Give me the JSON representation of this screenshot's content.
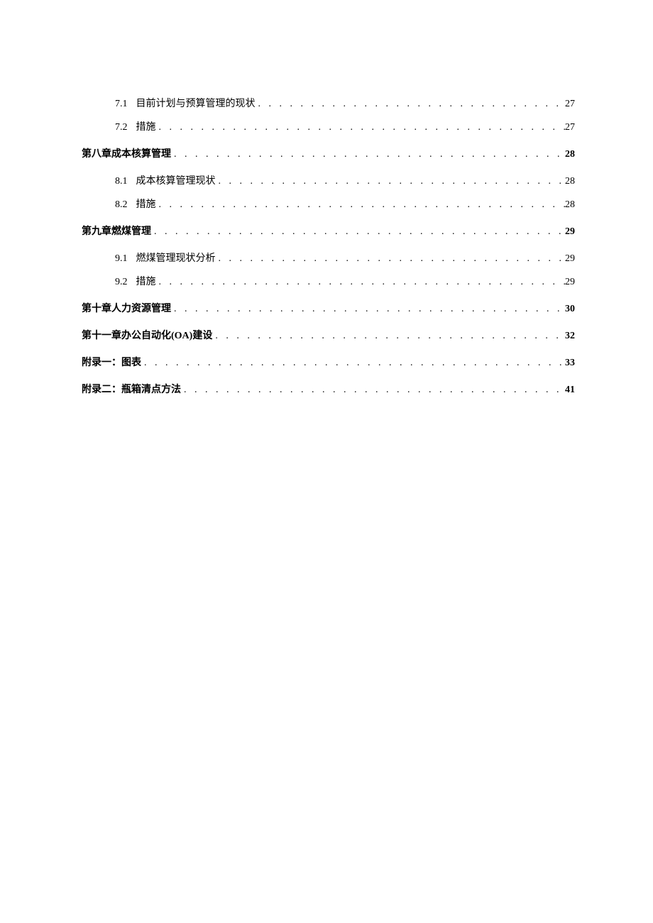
{
  "toc": {
    "entries": [
      {
        "level": 2,
        "number": "7.1",
        "title": "目前计划与预算管理的现状",
        "page": "27"
      },
      {
        "level": 2,
        "number": "7.2",
        "title": "措施",
        "page": "27"
      },
      {
        "level": 1,
        "number": "",
        "title": "第八章成本核算管理",
        "page": "28"
      },
      {
        "level": 2,
        "number": "8.1",
        "title": "成本核算管理现状",
        "page": "28"
      },
      {
        "level": 2,
        "number": "8.2",
        "title": "措施",
        "page": "28"
      },
      {
        "level": 1,
        "number": "",
        "title": "第九章燃煤管理",
        "page": "29"
      },
      {
        "level": 2,
        "number": "9.1",
        "title": "燃煤管理现状分析",
        "page": "29"
      },
      {
        "level": 2,
        "number": "9.2",
        "title": "措施",
        "page": "29"
      },
      {
        "level": 1,
        "number": "",
        "title": "第十章人力资源管理",
        "page": "30"
      },
      {
        "level": 1,
        "number": "",
        "title": "第十一章办公自动化(OA)建设",
        "page": "32"
      },
      {
        "level": 1,
        "number": "",
        "title": "附录一：图表",
        "page": "33"
      },
      {
        "level": 1,
        "number": "",
        "title": "附录二：瓶箱清点方法",
        "page": "41"
      }
    ],
    "dots": ". . . . . . . . . . . . . . . . . . . . . . . . . . . . . . . . . . . . . . . . . . . . . . . . . . . . . . . . . . . . . . . . . . . . . . . . . . . . . . . . . . . . . . . . . . . . . . . . . . . ."
  }
}
